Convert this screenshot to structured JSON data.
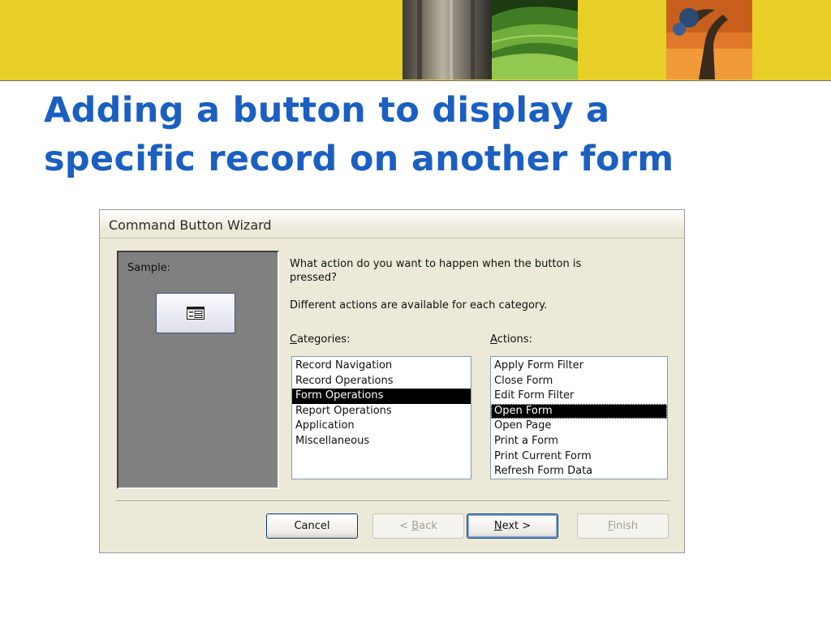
{
  "slide": {
    "title_line1": "Adding a button to display a",
    "title_line2": "specific record on another form"
  },
  "wizard": {
    "title": "Command Button Wizard",
    "sample_label": "Sample:",
    "prompt": "What action do you want to happen when the button is pressed?",
    "prompt2": "Different actions are available for each category.",
    "categories_label": {
      "hotkey": "C",
      "rest": "ategories:"
    },
    "actions_label": {
      "hotkey": "A",
      "rest": "ctions:"
    },
    "categories": [
      "Record Navigation",
      "Record Operations",
      "Form Operations",
      "Report Operations",
      "Application",
      "Miscellaneous"
    ],
    "selected_category": "Form Operations",
    "actions": [
      "Apply Form Filter",
      "Close Form",
      "Edit Form Filter",
      "Open Form",
      "Open Page",
      "Print a Form",
      "Print Current Form",
      "Refresh Form Data"
    ],
    "selected_action": "Open Form",
    "buttons": {
      "cancel": "Cancel",
      "back": {
        "prefix": "< ",
        "hotkey": "B",
        "rest": "ack"
      },
      "next": {
        "hotkey": "N",
        "rest": "ext >"
      },
      "finish": {
        "hotkey": "F",
        "rest": "inish"
      }
    }
  },
  "colors": {
    "title_blue": "#1a5fc1",
    "band_yellow": "#e8cf27",
    "selection_black": "#000000"
  }
}
